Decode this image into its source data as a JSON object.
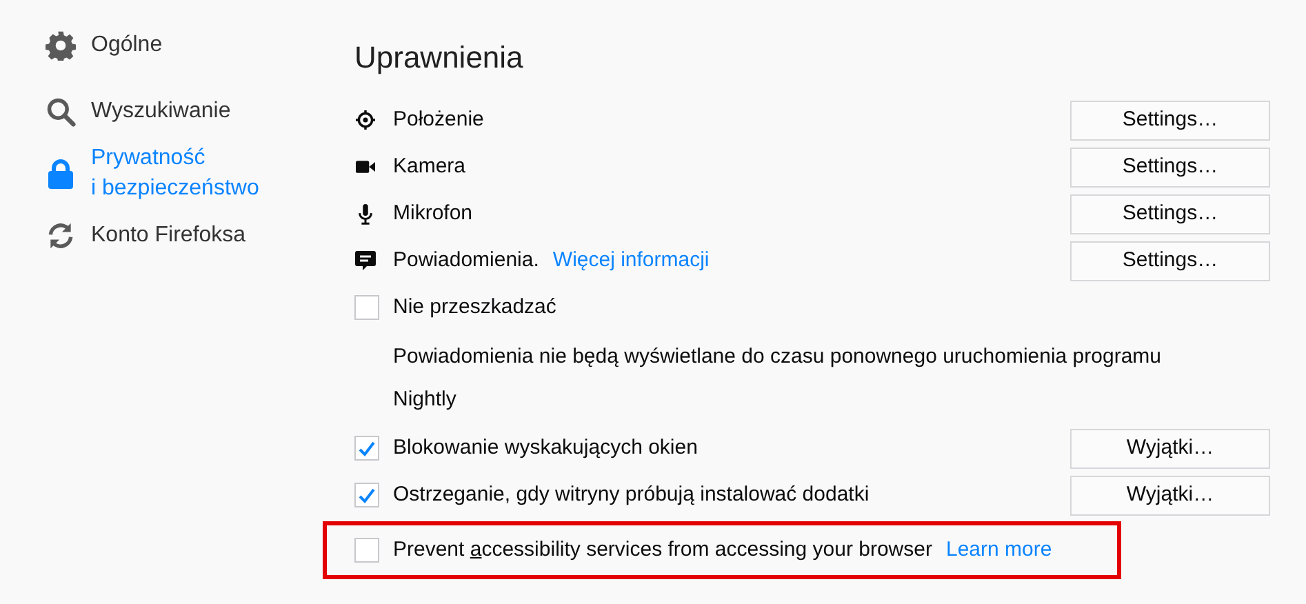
{
  "sidebar": {
    "items": [
      {
        "label": "Ogólne",
        "selected": false
      },
      {
        "label": "Wyszukiwanie",
        "selected": false
      },
      {
        "label": "Prywatność\ni bezpieczeństwo",
        "selected": true
      },
      {
        "label": "Konto Firefoksa",
        "selected": false
      }
    ]
  },
  "section": {
    "title": "Uprawnienia",
    "rows": [
      {
        "kind": "permission",
        "label": "Położenie",
        "button": "Settings…"
      },
      {
        "kind": "permission",
        "label": "Kamera",
        "button": "Settings…"
      },
      {
        "kind": "permission",
        "label": "Mikrofon",
        "button": "Settings…"
      },
      {
        "kind": "permission",
        "label": "Powiadomienia.",
        "link": "Więcej informacji",
        "button": "Settings…"
      },
      {
        "kind": "checkbox",
        "label": "Nie przeszkadzać",
        "checked": false
      },
      {
        "kind": "note",
        "label": "Powiadomienia nie będą wyświetlane do czasu ponownego uruchomienia programu Nightly"
      },
      {
        "kind": "checkbox",
        "label": "Blokowanie wyskakujących okien",
        "checked": true,
        "button": "Wyjątki…"
      },
      {
        "kind": "checkbox",
        "label": "Ostrzeganie, gdy witryny próbują instalować dodatki",
        "checked": true,
        "button": "Wyjątki…"
      },
      {
        "kind": "checkbox",
        "label_before": "Prevent ",
        "access_key": "a",
        "label_after": "ccessibility services from accessing your browser",
        "link": "Learn more",
        "checked": false,
        "highlighted": true
      }
    ]
  }
}
